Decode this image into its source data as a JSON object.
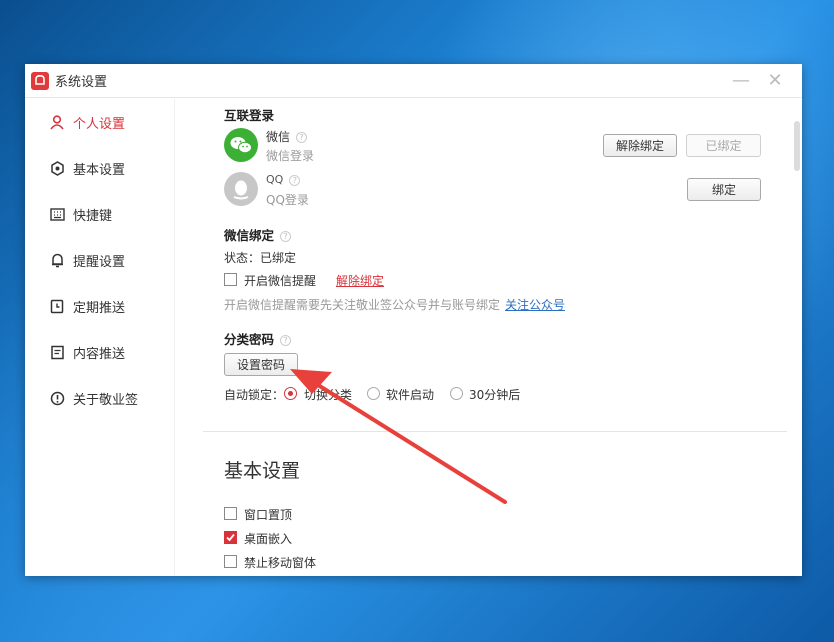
{
  "window": {
    "title": "系统设置",
    "minimize_label": "—",
    "close_label": "✕"
  },
  "sidebar": {
    "items": [
      {
        "label": "个人设置",
        "icon": "user-icon",
        "active": true
      },
      {
        "label": "基本设置",
        "icon": "settings-hex-icon",
        "active": false
      },
      {
        "label": "快捷键",
        "icon": "keyboard-icon",
        "active": false
      },
      {
        "label": "提醒设置",
        "icon": "bell-icon",
        "active": false
      },
      {
        "label": "定期推送",
        "icon": "clock-icon",
        "active": false
      },
      {
        "label": "内容推送",
        "icon": "document-icon",
        "active": false
      },
      {
        "label": "关于敬业签",
        "icon": "info-icon",
        "active": false
      }
    ]
  },
  "personal": {
    "login_section_title": "互联登录",
    "wechat": {
      "name": "微信",
      "sub": "微信登录",
      "unbind_button": "解除绑定",
      "bound_button": "已绑定"
    },
    "qq": {
      "name": "QQ",
      "sub": "QQ登录",
      "bind_button": "绑定"
    },
    "wechat_bind": {
      "title": "微信绑定",
      "status": "状态：已绑定",
      "reminder_checkbox": "开启微信提醒",
      "unbind_link": "解除绑定",
      "hint": "开启微信提醒需要先关注敬业签公众号并与账号绑定",
      "follow_link": "关注公众号"
    },
    "category_password": {
      "title": "分类密码",
      "set_button": "设置密码",
      "auto_lock_label": "自动锁定：",
      "options": [
        {
          "label": "切换分类",
          "checked": true
        },
        {
          "label": "软件启动",
          "checked": false
        },
        {
          "label": "30分钟后",
          "checked": false
        }
      ]
    }
  },
  "basic": {
    "title": "基本设置",
    "options": [
      {
        "label": "窗口置顶",
        "checked": false
      },
      {
        "label": "桌面嵌入",
        "checked": true
      },
      {
        "label": "禁止移动窗体",
        "checked": false
      }
    ]
  },
  "colors": {
    "accent": "#d9323a",
    "wechat_green": "#3cb034",
    "link_blue": "#2b6fc4",
    "arrow": "#e8403a"
  }
}
